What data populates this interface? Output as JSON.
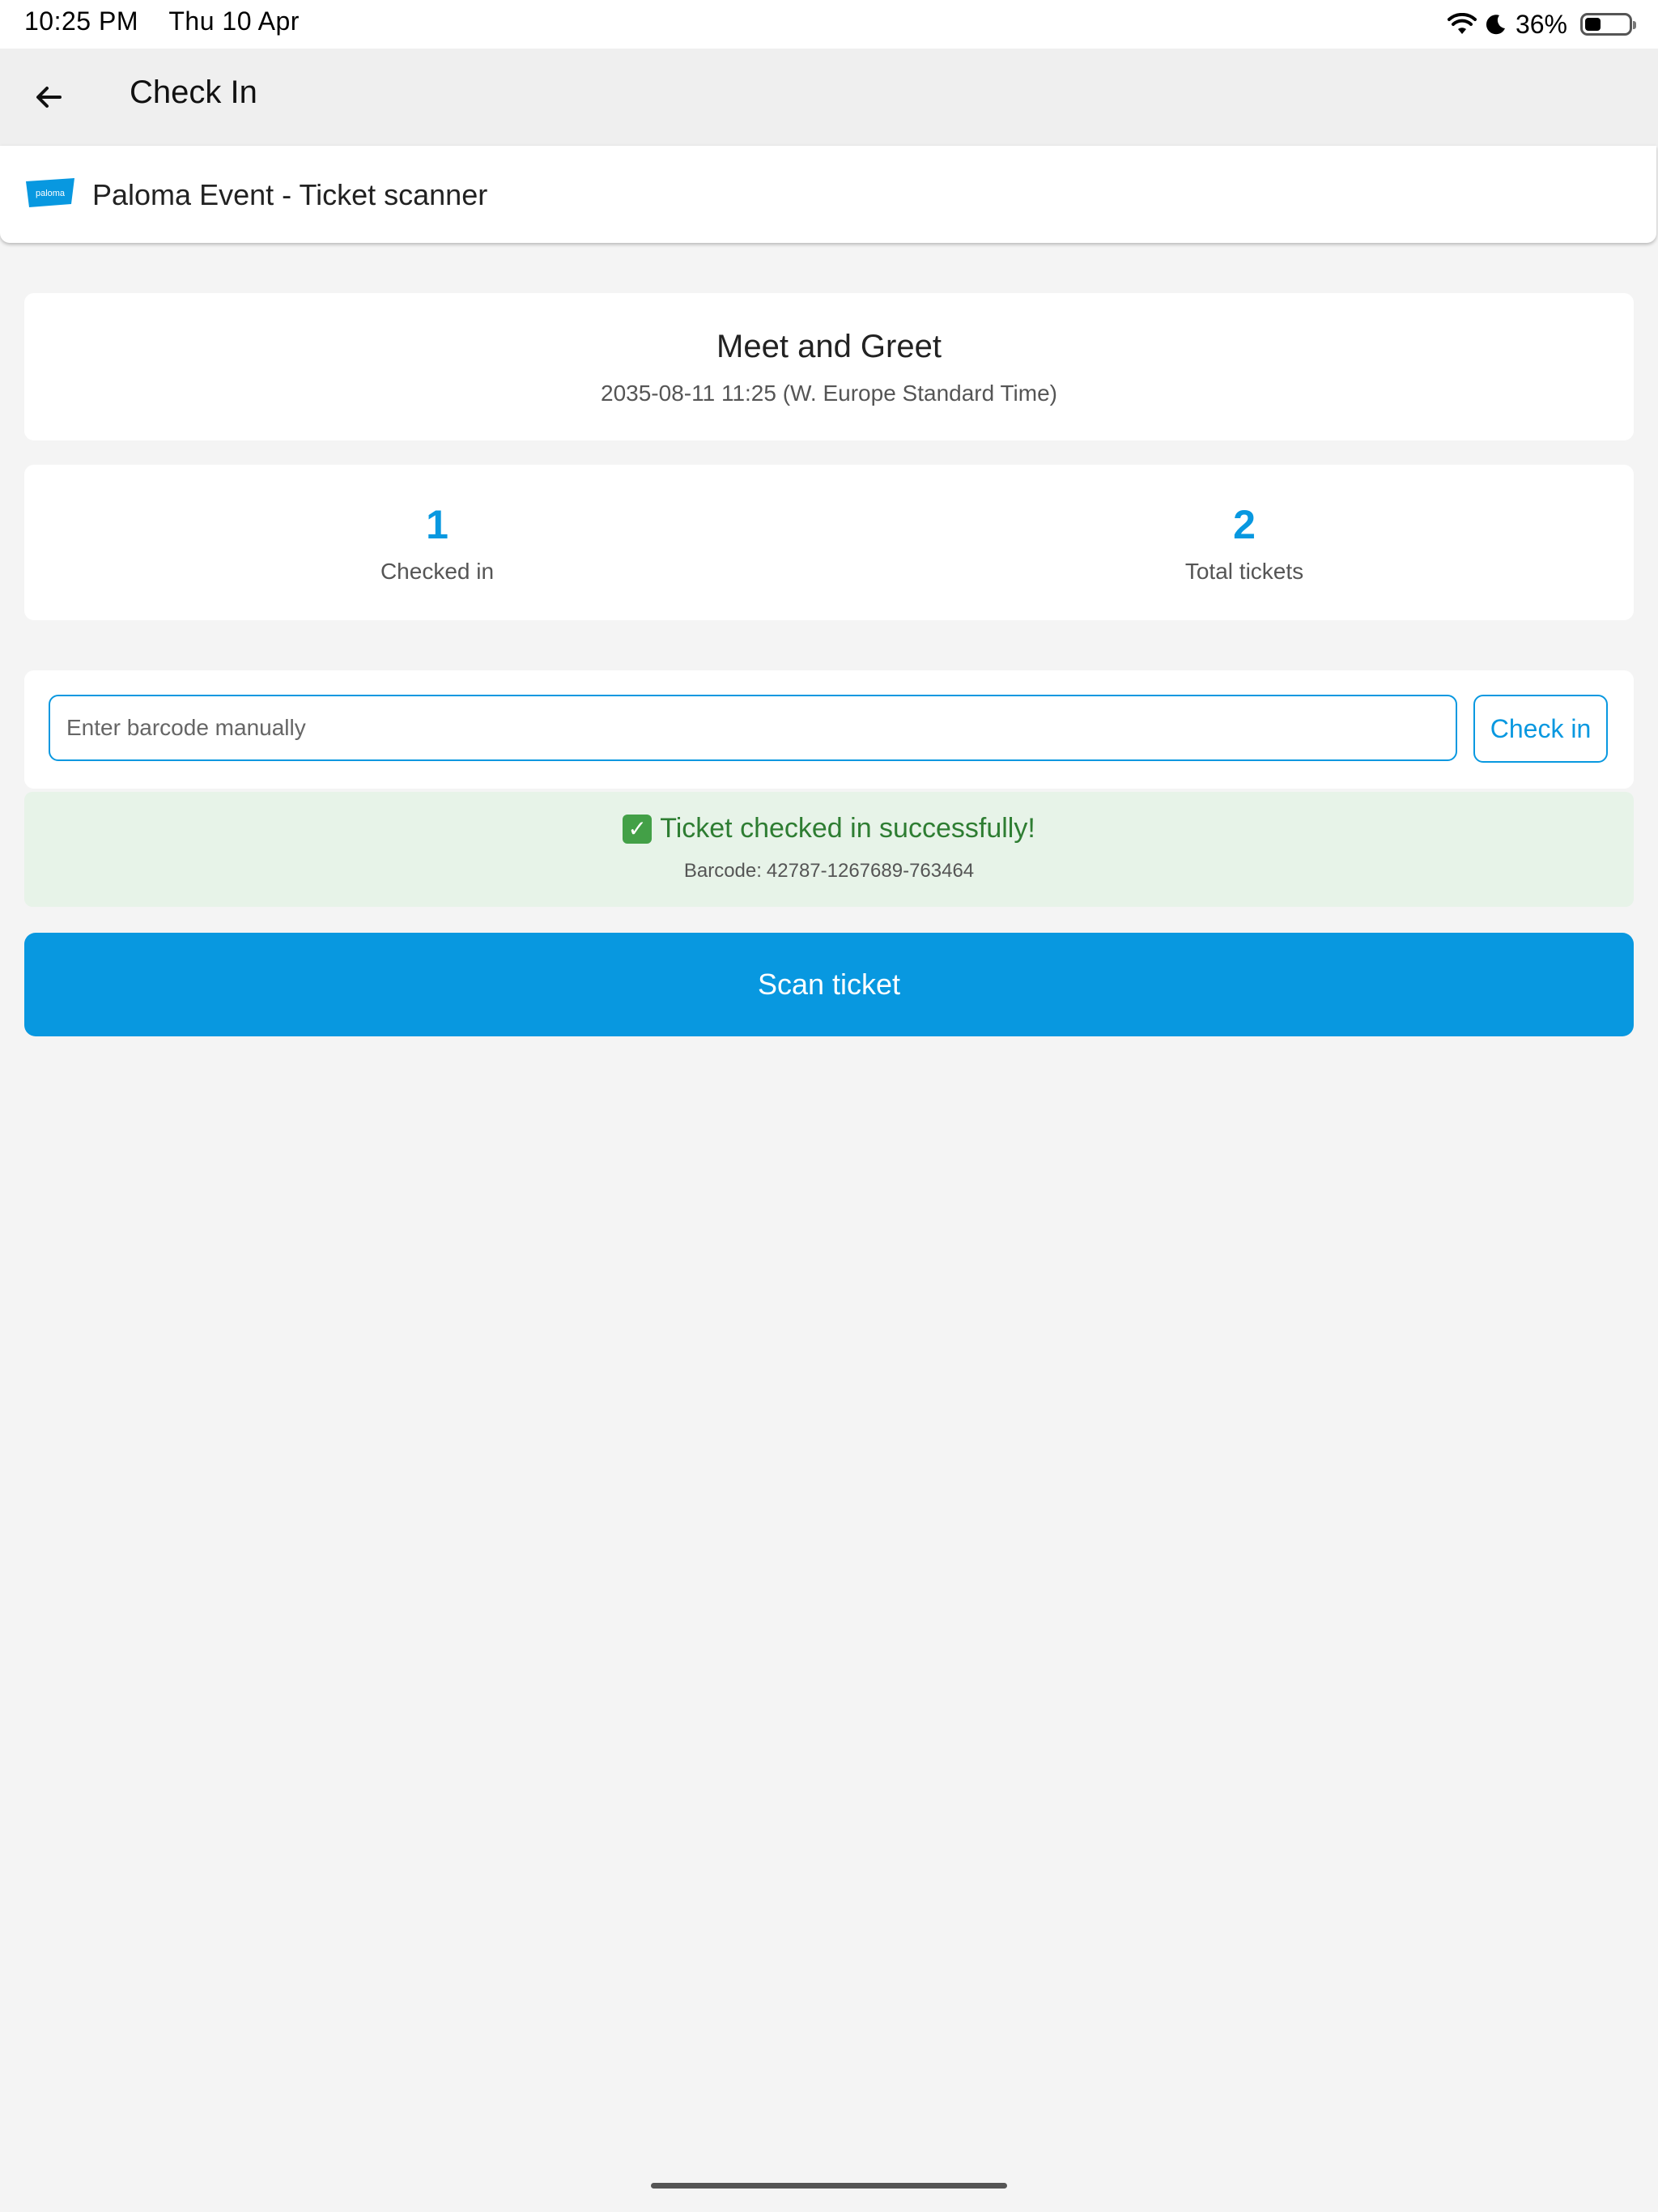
{
  "status_bar": {
    "time": "10:25 PM",
    "date": "Thu 10 Apr",
    "battery_percent": "36%",
    "battery_level": 0.36,
    "icons": [
      "wifi-icon",
      "moon-icon",
      "battery-icon"
    ]
  },
  "app_bar": {
    "title": "Check In",
    "back_icon": "arrow-left-icon"
  },
  "scanner": {
    "title": "Paloma Event - Ticket scanner",
    "logo_text": "paloma"
  },
  "event": {
    "name": "Meet and Greet",
    "datetime": "2035-08-11 11:25 (W. Europe Standard Time)"
  },
  "stats": {
    "checked_in_value": "1",
    "checked_in_label": "Checked in",
    "total_value": "2",
    "total_label": "Total tickets"
  },
  "manual_entry": {
    "placeholder": "Enter barcode manually",
    "value": "",
    "button_label": "Check in"
  },
  "result": {
    "message": "Ticket checked in successfully!",
    "barcode_label": "Barcode:",
    "barcode_value": "42787-1267689-763464"
  },
  "scan_button_label": "Scan ticket",
  "colors": {
    "accent": "#0898e0",
    "success_bg": "#e7f3e8",
    "success_text": "#2e7d32"
  }
}
